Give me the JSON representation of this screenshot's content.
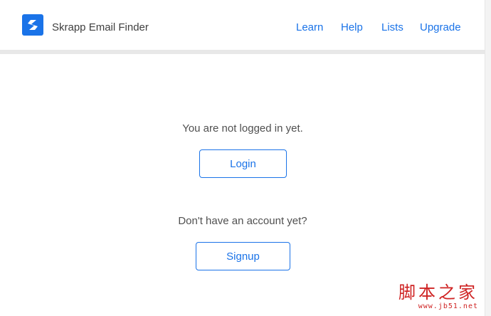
{
  "header": {
    "app_title": "Skrapp Email Finder",
    "nav": [
      "Learn",
      "Help",
      "Lists",
      "Upgrade"
    ],
    "logo_icon": "skrapp-s-logo"
  },
  "main": {
    "not_logged_in_text": "You are not logged in yet.",
    "login_label": "Login",
    "no_account_text": "Don't have an account yet?",
    "signup_label": "Signup"
  },
  "watermark": {
    "chinese": "脚本之家",
    "url": "www.jb51.net"
  },
  "colors": {
    "accent": "#1a73e8",
    "text": "#505050",
    "watermark": "#cf2323"
  }
}
